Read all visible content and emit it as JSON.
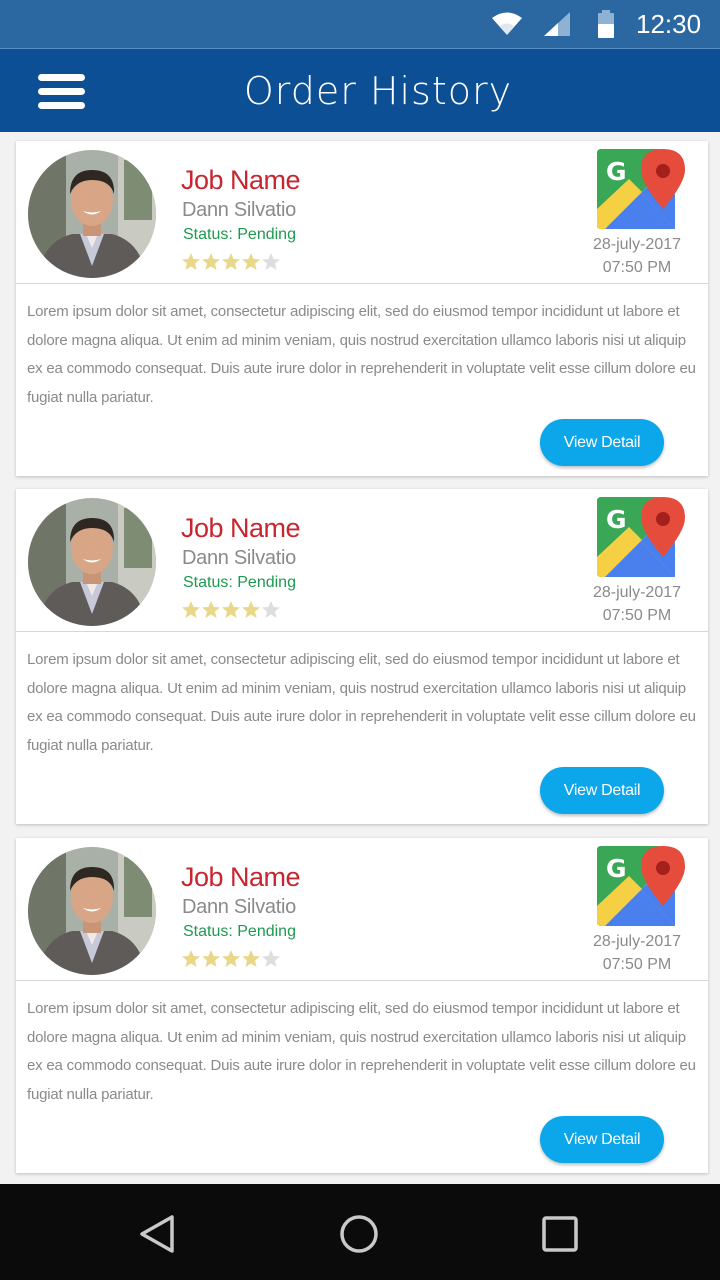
{
  "status_bar": {
    "time": "12:30",
    "icons": [
      "wifi-icon",
      "signal-icon",
      "battery-icon"
    ]
  },
  "header": {
    "title": "Order History",
    "menu_icon": "hamburger-menu-icon"
  },
  "colors": {
    "status_bar": "#2b67a0",
    "app_bar": "#0d4f95",
    "job_name": "#c8262f",
    "status_text": "#1e9a50",
    "button": "#0ba7ea",
    "star_filled": "#e9d889",
    "star_empty": "#dedede"
  },
  "orders": [
    {
      "job_name": "Job Name",
      "person": "Dann Silvatio",
      "status": "Status: Pending",
      "rating": 4,
      "rating_max": 5,
      "date": "28-july-2017",
      "time": "07:50 PM",
      "description": "Lorem ipsum dolor sit amet, consectetur adipiscing elit, sed do eiusmod tempor incididunt ut labore et dolore magna aliqua. Ut enim ad minim veniam, quis nostrud exercitation ullamco laboris nisi ut aliquip ex ea commodo consequat. Duis aute irure dolor in reprehenderit in voluptate velit esse cillum dolore eu fugiat nulla pariatur.",
      "button_label": "View Detail"
    },
    {
      "job_name": "Job Name",
      "person": "Dann Silvatio",
      "status": "Status: Pending",
      "rating": 4,
      "rating_max": 5,
      "date": "28-july-2017",
      "time": "07:50 PM",
      "description": "Lorem ipsum dolor sit amet, consectetur adipiscing elit, sed do eiusmod tempor incididunt ut labore et dolore magna aliqua. Ut enim ad minim veniam, quis nostrud exercitation ullamco laboris nisi ut aliquip ex ea commodo consequat. Duis aute irure dolor in reprehenderit in voluptate velit esse cillum dolore eu fugiat nulla pariatur.",
      "button_label": "View Detail"
    },
    {
      "job_name": "Job Name",
      "person": "Dann Silvatio",
      "status": "Status: Pending",
      "rating": 4,
      "rating_max": 5,
      "date": "28-july-2017",
      "time": "07:50 PM",
      "description": "Lorem ipsum dolor sit amet, consectetur adipiscing elit, sed do eiusmod tempor incididunt ut labore et dolore magna aliqua. Ut enim ad minim veniam, quis nostrud exercitation ullamco laboris nisi ut aliquip ex ea commodo consequat. Duis aute irure dolor in reprehenderit in voluptate velit esse cillum dolore eu fugiat nulla pariatur.",
      "button_label": "View Detail"
    }
  ],
  "nav_bar": {
    "icons": [
      "back-icon",
      "home-icon",
      "recents-icon"
    ]
  }
}
